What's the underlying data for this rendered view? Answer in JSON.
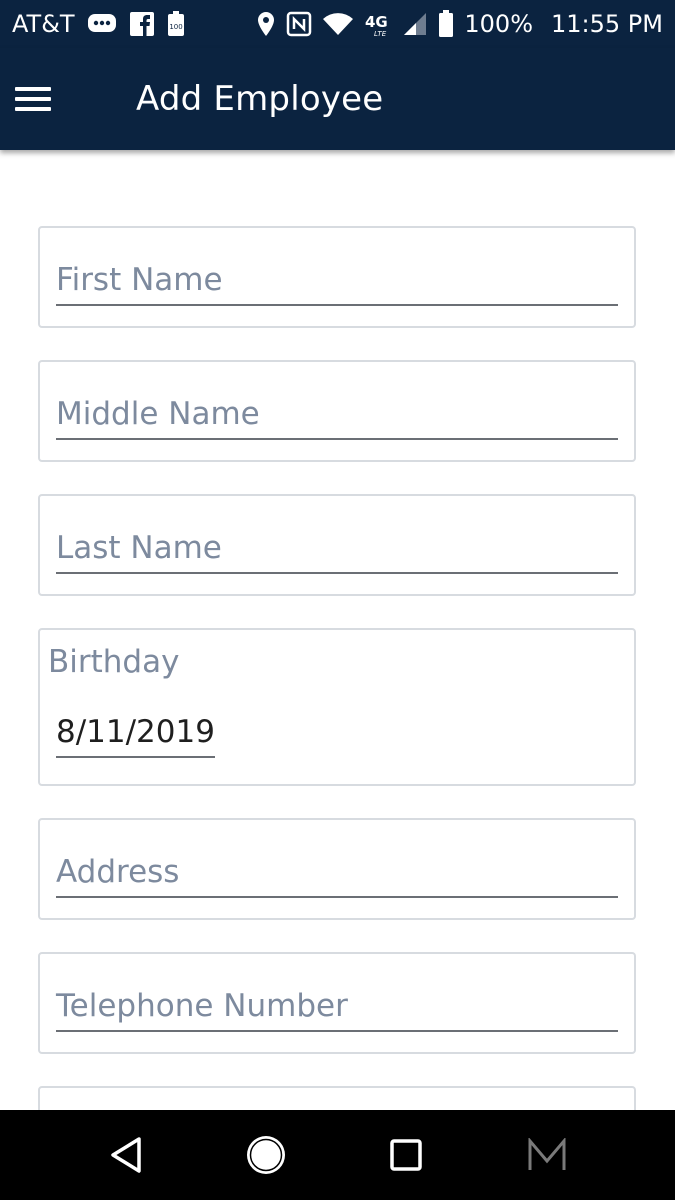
{
  "status_bar": {
    "carrier": "AT&T",
    "battery_percent": "100%",
    "time": "11:55 PM",
    "icons": [
      "messages-icon",
      "facebook-icon",
      "battery-saver-icon",
      "location-icon",
      "nfc-icon",
      "wifi-icon",
      "4g-lte-icon",
      "signal-icon",
      "battery-icon"
    ],
    "battery_level": 1.0
  },
  "app_bar": {
    "title": "Add Employee",
    "menu_icon": "menu-icon",
    "background": "#0b2340"
  },
  "form": {
    "first_name": {
      "placeholder": "First Name",
      "value": ""
    },
    "middle_name": {
      "placeholder": "Middle Name",
      "value": ""
    },
    "last_name": {
      "placeholder": "Last Name",
      "value": ""
    },
    "birthday": {
      "label": "Birthday",
      "value": "8/11/2019"
    },
    "address": {
      "placeholder": "Address",
      "value": ""
    },
    "telephone": {
      "placeholder": "Telephone Number",
      "value": ""
    }
  },
  "nav_bar": {
    "buttons": [
      "back-icon",
      "home-icon",
      "recents-icon",
      "app-m-icon"
    ]
  }
}
